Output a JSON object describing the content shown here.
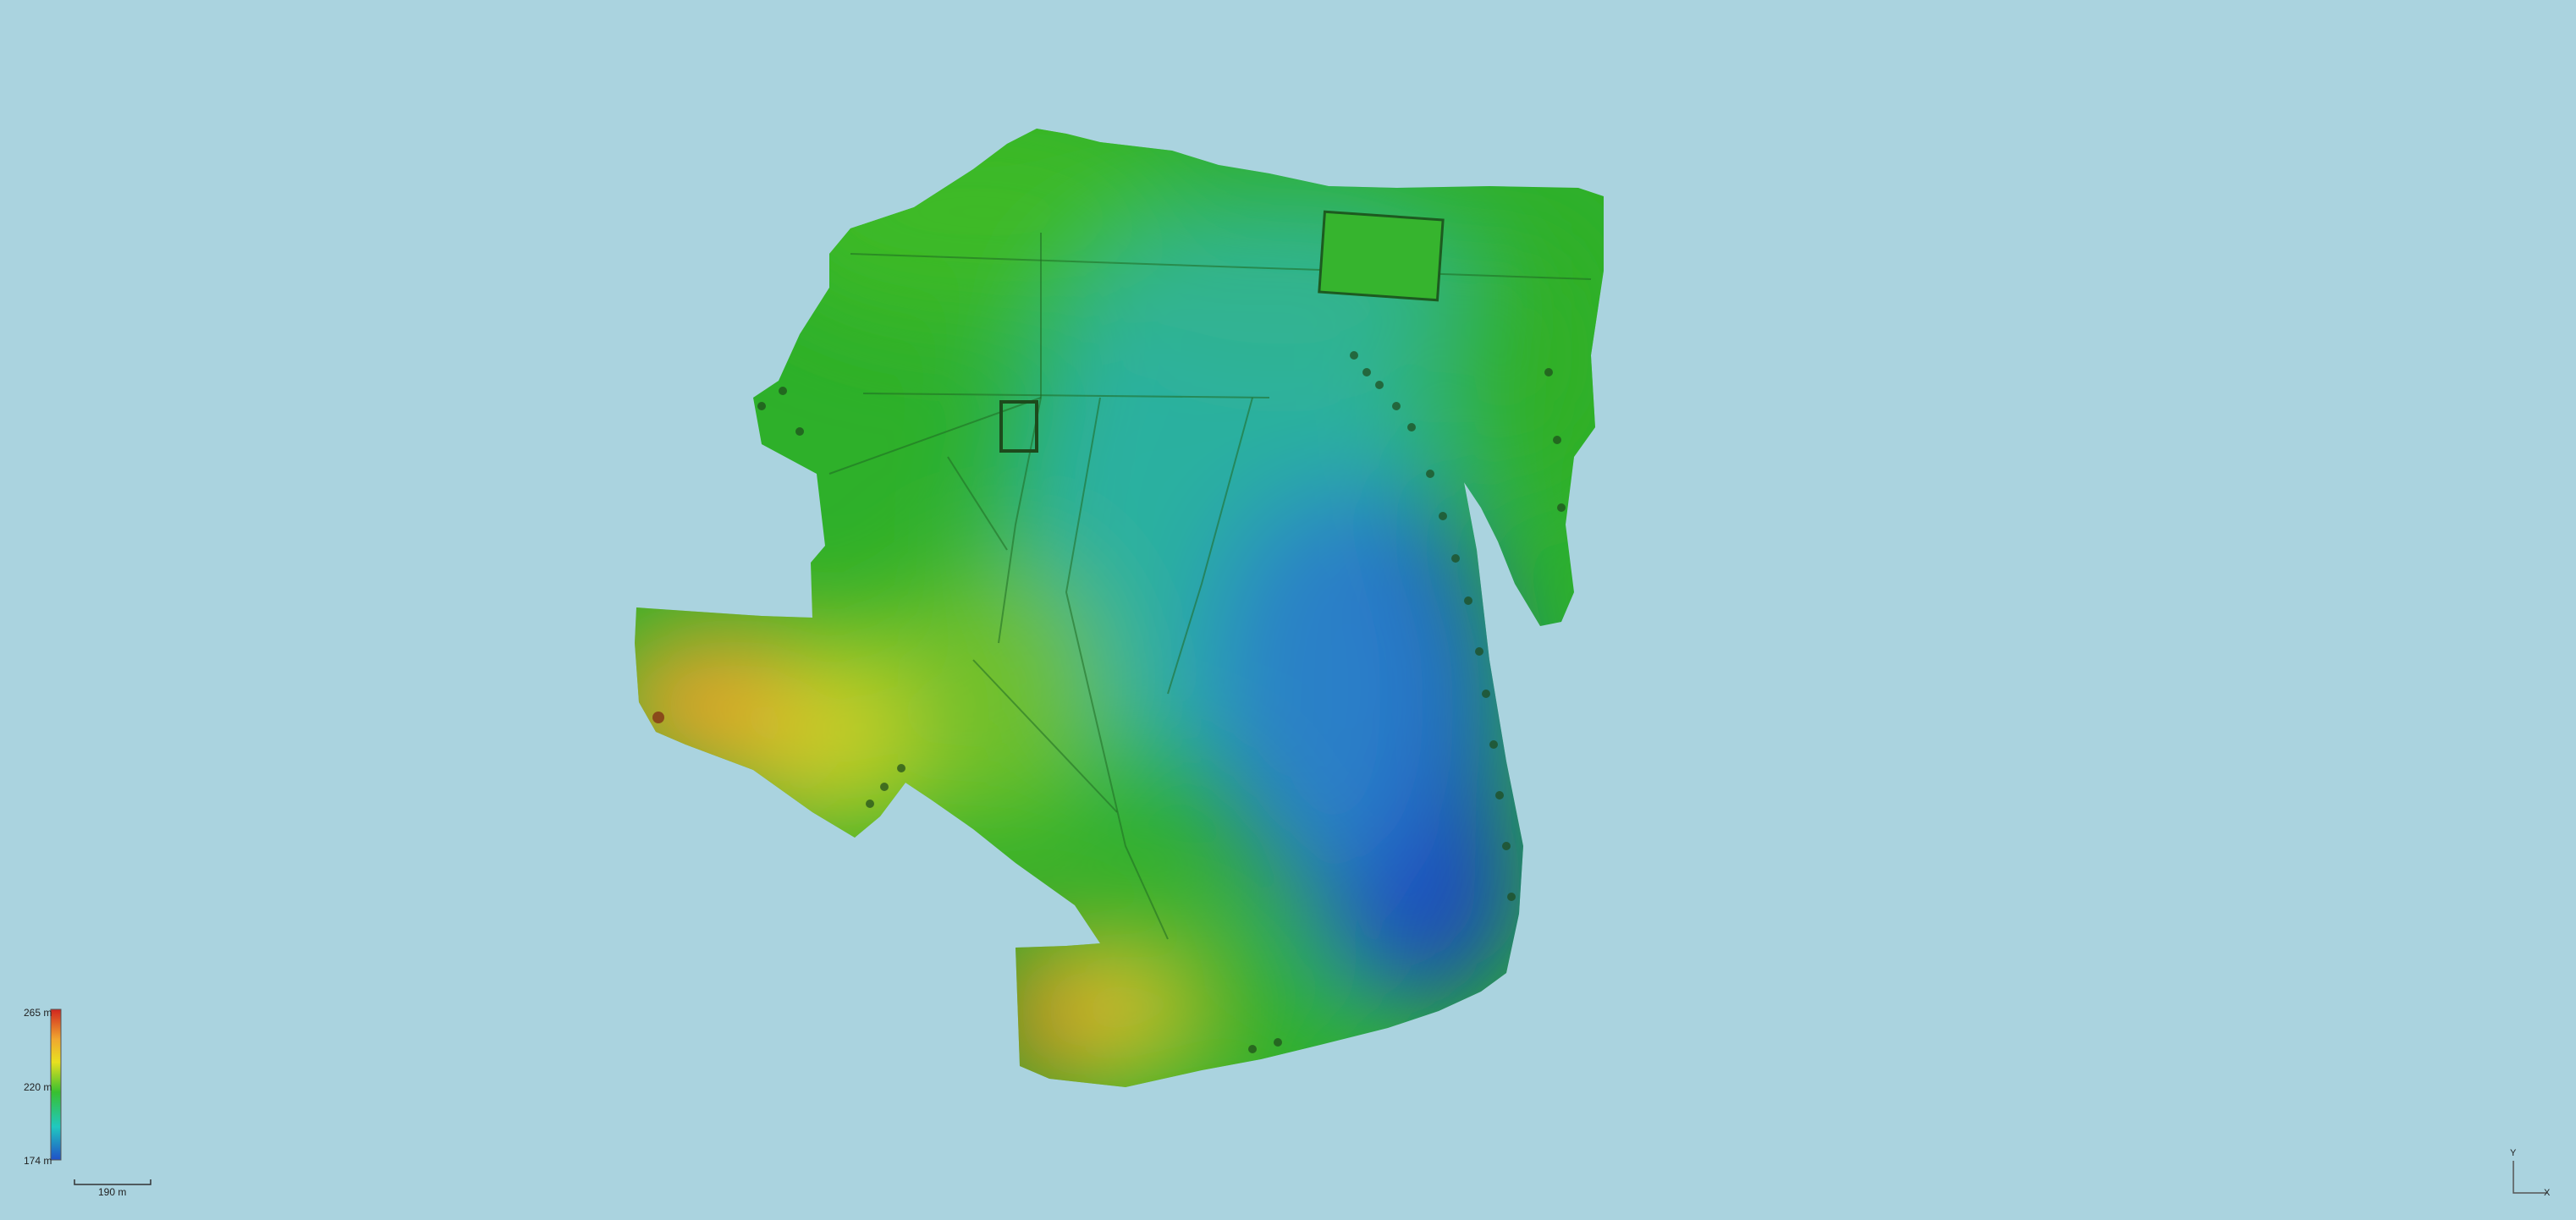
{
  "legend": {
    "max_label": "265 m",
    "mid_label": "220 m",
    "min_label": "174 m",
    "colors": [
      "#d1261f",
      "#f0a830",
      "#e8e020",
      "#38c030",
      "#20c8c0",
      "#2050c8"
    ]
  },
  "scale": {
    "label": "190 m"
  },
  "axes": {
    "y_label": "Y",
    "x_label": "X"
  },
  "map": {
    "background": "#aad3df",
    "terrain_colors": {
      "high": "#c8321e",
      "upper": "#e8a028",
      "mid": "#34b428",
      "lower": "#2aaa9a",
      "low": "#1e56c0"
    }
  }
}
